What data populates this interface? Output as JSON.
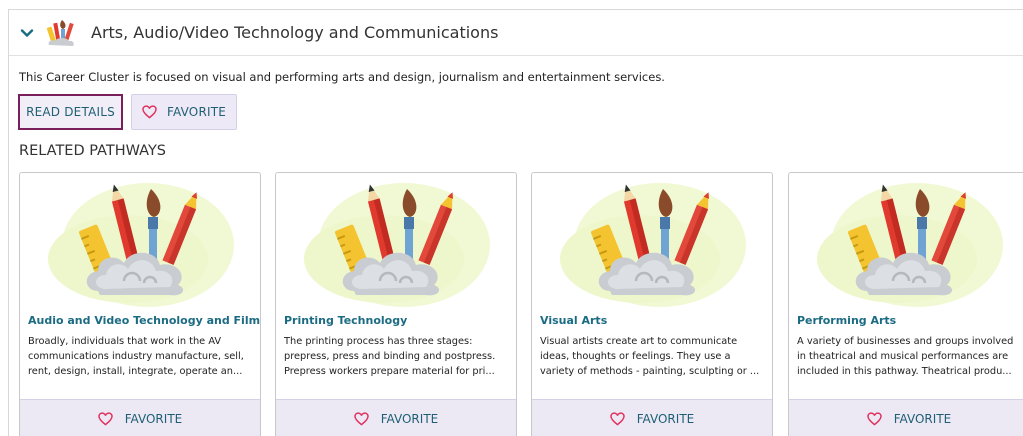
{
  "cluster": {
    "title": "Arts, Audio/Video Technology and Communications",
    "description": "This Career Cluster is focused on visual and performing arts and design, journalism and entertainment services.",
    "read_details_label": "READ DETAILS",
    "favorite_label": "FAVORITE",
    "icon": "art-supplies-icon",
    "accent_color": "#7a1f5c",
    "link_color": "#1b6b83"
  },
  "related": {
    "title": "RELATED PATHWAYS",
    "cards": [
      {
        "title": "Audio and Video Technology and Film",
        "desc_lines": [
          "Broadly, individuals that work in the AV",
          "communications industry manufacture, sell,",
          "rent, design, install, integrate, operate an..."
        ],
        "favorite_label": "FAVORITE"
      },
      {
        "title": "Printing Technology",
        "desc_lines": [
          "The printing process has three stages:",
          "prepress, press and binding and postpress.",
          "Prepress workers prepare material for pri..."
        ],
        "favorite_label": "FAVORITE"
      },
      {
        "title": "Visual Arts",
        "desc_lines": [
          "Visual artists create art to communicate",
          "ideas, thoughts or feelings. They use a",
          "variety of methods - painting, sculpting or ..."
        ],
        "favorite_label": "FAVORITE"
      },
      {
        "title": "Performing Arts",
        "desc_lines": [
          "A variety of businesses and groups involved",
          "in theatrical and musical performances are",
          "included in this pathway. Theatrical produ..."
        ],
        "favorite_label": "FAVORITE"
      }
    ]
  }
}
